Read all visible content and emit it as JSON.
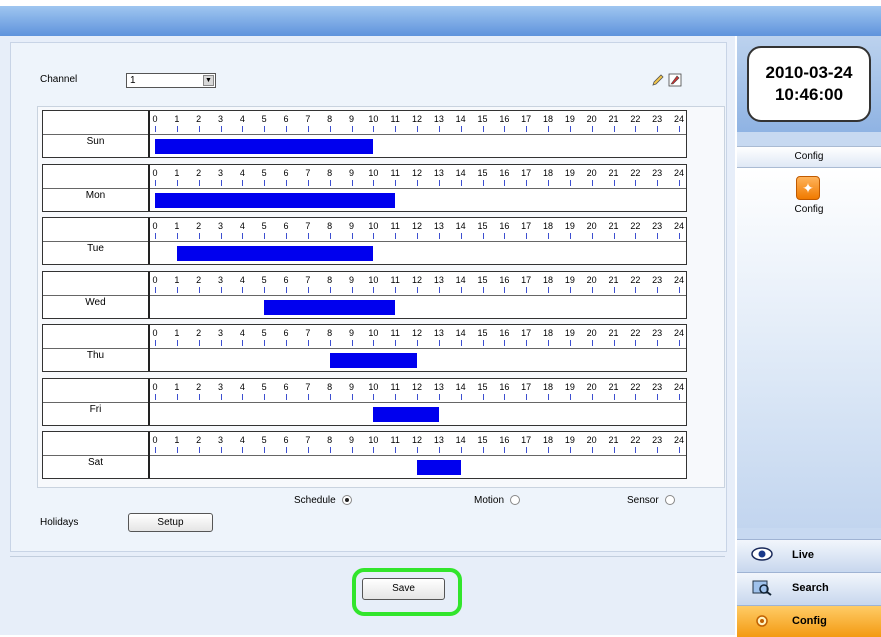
{
  "channel": {
    "label": "Channel",
    "value": "1"
  },
  "hour_ticks": [
    "0",
    "1",
    "2",
    "3",
    "4",
    "5",
    "6",
    "7",
    "8",
    "9",
    "10",
    "11",
    "12",
    "13",
    "14",
    "15",
    "16",
    "17",
    "18",
    "19",
    "20",
    "21",
    "22",
    "23",
    "24"
  ],
  "days": [
    {
      "name": "Sun",
      "start": 0,
      "end": 10
    },
    {
      "name": "Mon",
      "start": 0,
      "end": 11
    },
    {
      "name": "Tue",
      "start": 1,
      "end": 10
    },
    {
      "name": "Wed",
      "start": 5,
      "end": 11
    },
    {
      "name": "Thu",
      "start": 8,
      "end": 12
    },
    {
      "name": "Fri",
      "start": 10,
      "end": 13
    },
    {
      "name": "Sat",
      "start": 12,
      "end": 14
    }
  ],
  "record_type": {
    "options": [
      "Schedule",
      "Motion",
      "Sensor"
    ],
    "selected": "Schedule"
  },
  "holidays": {
    "label": "Holidays",
    "button": "Setup"
  },
  "save_button": "Save",
  "clock": {
    "date": "2010-03-24",
    "time": "10:46:00"
  },
  "side_panel": {
    "header": "Config",
    "item_label": "Config",
    "icon": "config-icon"
  },
  "side_nav": [
    {
      "label": "Live",
      "icon": "eye-icon",
      "active": false
    },
    {
      "label": "Search",
      "icon": "search-icon",
      "active": false
    },
    {
      "label": "Config",
      "icon": "config-icon",
      "active": true
    }
  ],
  "colors": {
    "schedule_bar": "#0000ee",
    "highlight": "#32e52c",
    "active_nav": "#f39a12"
  }
}
